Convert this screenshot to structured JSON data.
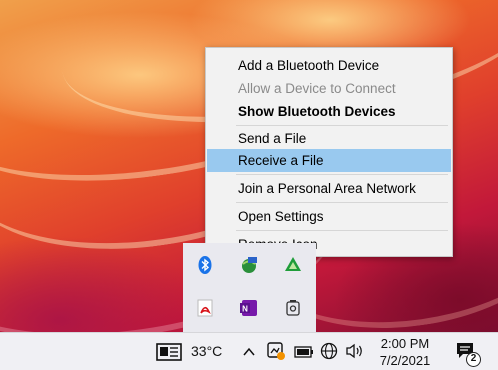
{
  "context_menu": {
    "items": [
      {
        "label": "Add a Bluetooth Device",
        "state": "normal"
      },
      {
        "label": "Allow a Device to Connect",
        "state": "disabled"
      },
      {
        "label": "Show Bluetooth Devices",
        "state": "default-bold"
      },
      {
        "label": "Send a File",
        "state": "normal"
      },
      {
        "label": "Receive a File",
        "state": "highlighted"
      },
      {
        "label": "Join a Personal Area Network",
        "state": "normal"
      },
      {
        "label": "Open Settings",
        "state": "normal"
      },
      {
        "label": "Remove Icon",
        "state": "normal"
      }
    ],
    "highlight_color": "#99c9ef"
  },
  "tray_flyout": {
    "icons": [
      "bluetooth-icon",
      "network-globe-icon",
      "drive-sync-icon",
      "pdf-reader-icon",
      "onenote-icon",
      "video-camera-icon"
    ]
  },
  "taskbar": {
    "weather_icon": "news-weather-icon",
    "temperature": "33°C",
    "clock_time": "2:00 PM",
    "clock_date": "7/2/2021",
    "notification_count": "2",
    "icons": [
      "chevron-up-icon",
      "tray-app-icon",
      "battery-icon",
      "globe-icon",
      "speaker-icon",
      "notification-icon"
    ]
  }
}
